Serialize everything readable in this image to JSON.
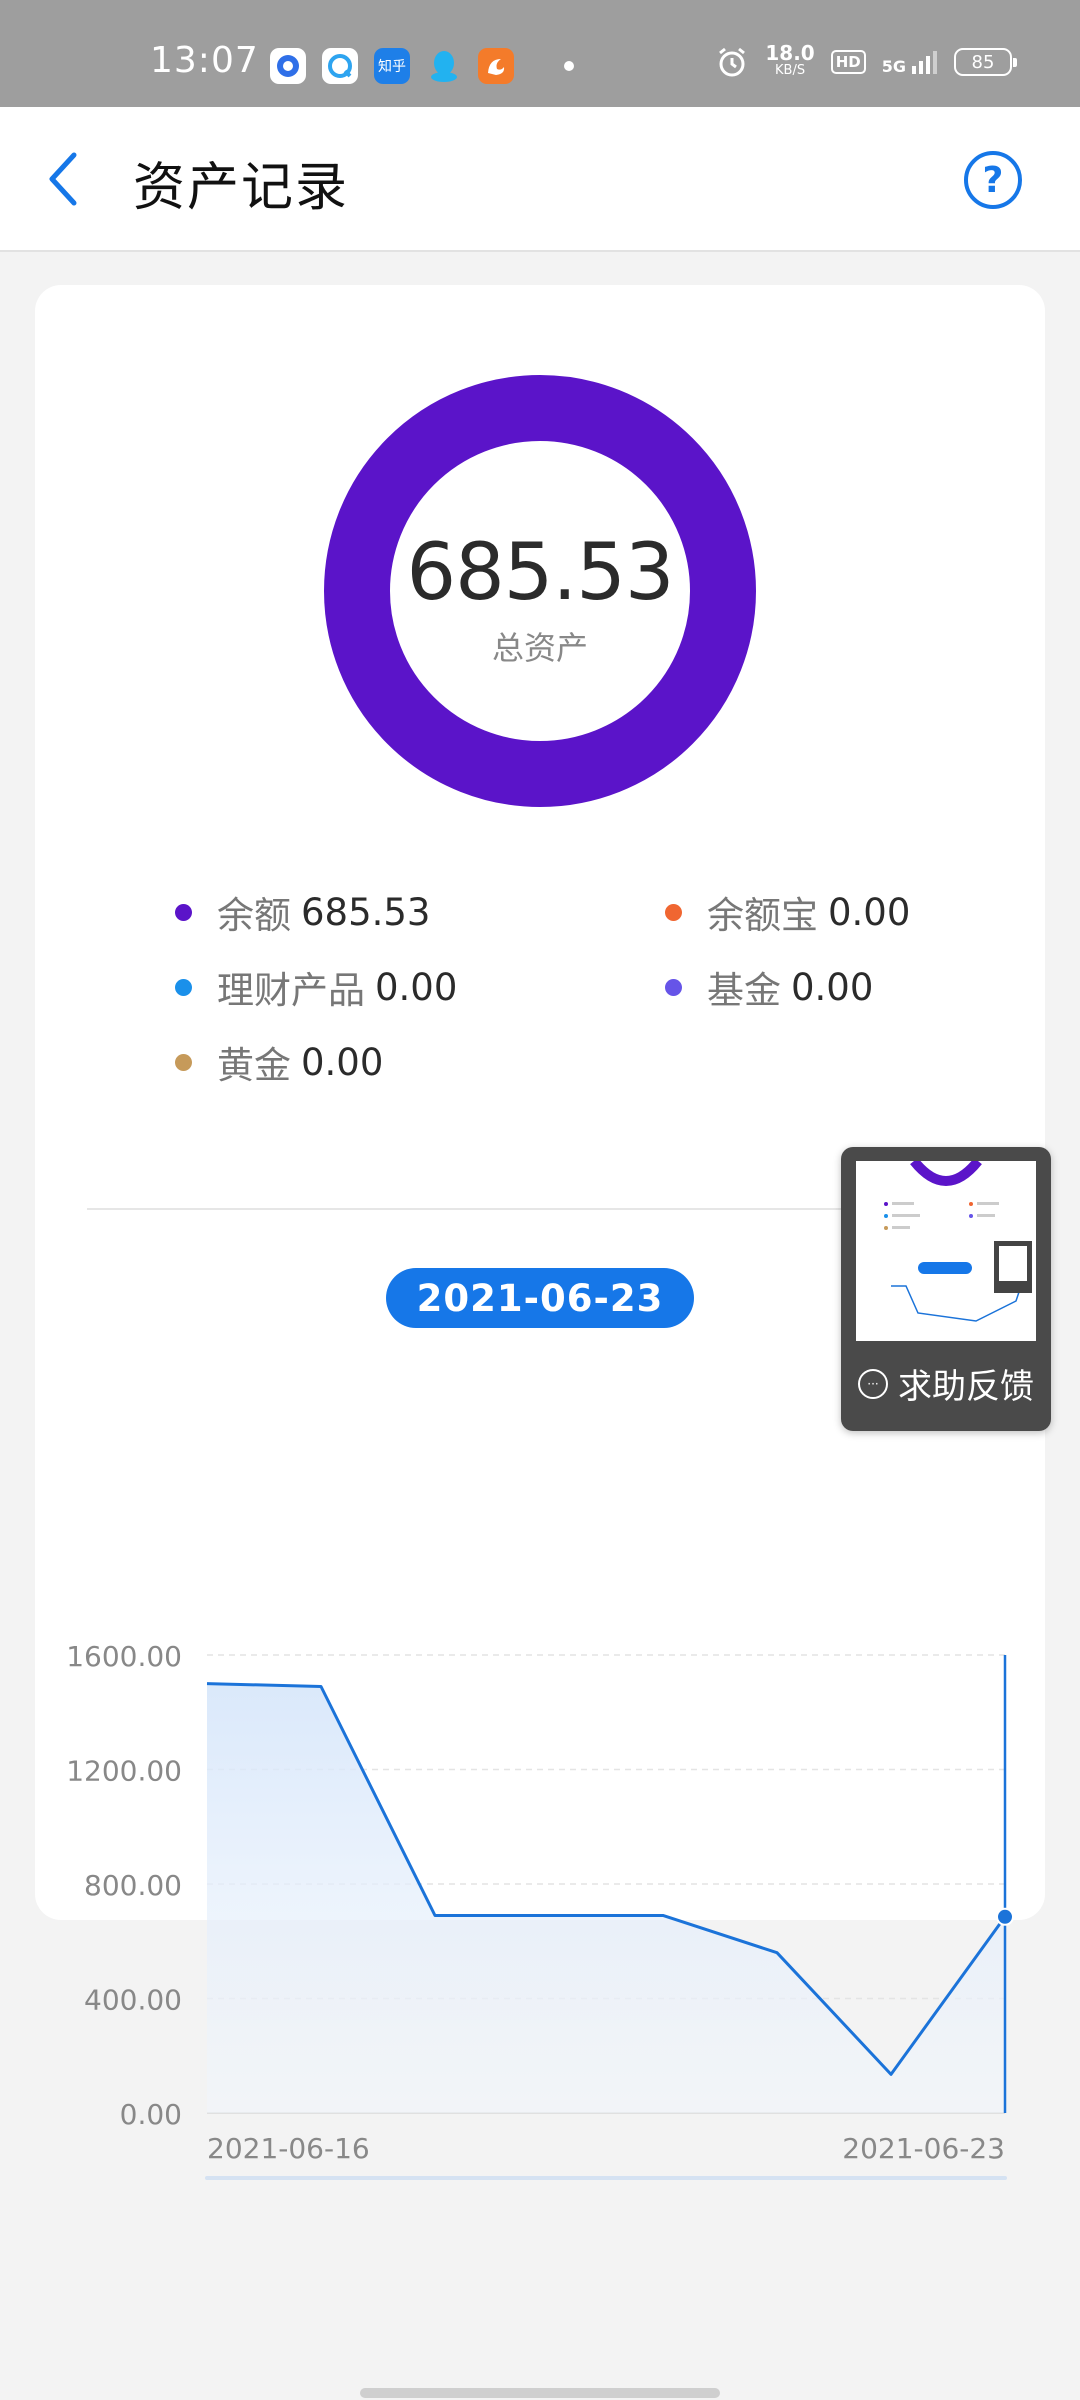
{
  "status_bar": {
    "time": "13:07",
    "net_speed": "18.0",
    "net_unit": "KB/S",
    "hd": "HD",
    "network": "5G",
    "battery": "85",
    "zhihu_label": "知乎"
  },
  "header": {
    "title": "资产记录",
    "help_symbol": "?"
  },
  "summary": {
    "total_value": "685.53",
    "total_label": "总资产",
    "ring_color": "#5b14c9"
  },
  "legend": [
    {
      "name": "余额",
      "value": "685.53",
      "color": "#5b14c9"
    },
    {
      "name": "余额宝",
      "value": "0.00",
      "color": "#f06631"
    },
    {
      "name": "理财产品",
      "value": "0.00",
      "color": "#1a90ea"
    },
    {
      "name": "基金",
      "value": "0.00",
      "color": "#6654e8"
    },
    {
      "name": "黄金",
      "value": "0.00",
      "color": "#c69a5a"
    }
  ],
  "selected_date": "2021-06-23",
  "chart_data": {
    "type": "area",
    "x": [
      "2021-06-16",
      "2021-06-17",
      "2021-06-18",
      "2021-06-19",
      "2021-06-20",
      "2021-06-21",
      "2021-06-22",
      "2021-06-23"
    ],
    "values": [
      1500,
      1490,
      690,
      690,
      690,
      560,
      135,
      685.53
    ],
    "ylim": [
      0,
      1600
    ],
    "yticks": [
      "1600.00",
      "1200.00",
      "800.00",
      "400.00",
      "0.00"
    ],
    "ytick_values": [
      1600,
      1200,
      800,
      400,
      0
    ],
    "xtick_labels": [
      "2021-06-16",
      "2021-06-23"
    ],
    "grid": true,
    "line_color": "#1b73d9"
  },
  "feedback": {
    "label": "求助反馈"
  }
}
